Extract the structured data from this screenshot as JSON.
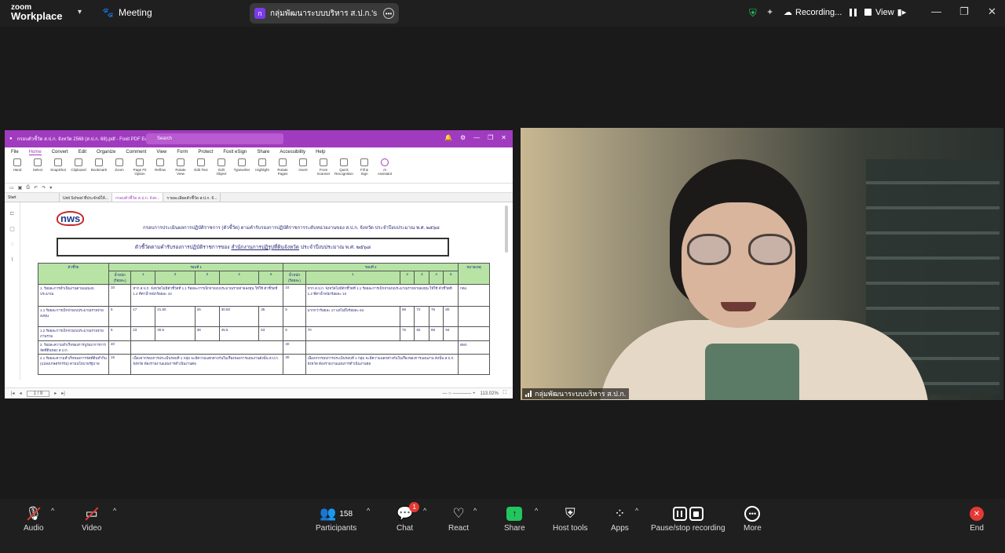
{
  "topbar": {
    "brand_top": "zoom",
    "brand_bottom": "Workplace",
    "meeting_label": "Meeting",
    "share_initial": "ก",
    "share_label": "กลุ่มพัฒนาระบบบริหาร ส.ป.ก.'s screen",
    "recording_label": "Recording...",
    "view_label": "View"
  },
  "pdf": {
    "title": "กรอบตัวชี้วัด ส.ป.ก. จังหวัด 2568 (ส.ป.ก. 68).pdf - Foxit PDF Editor",
    "search_placeholder": "Search",
    "menu": [
      "File",
      "Home",
      "Convert",
      "Edit",
      "Organize",
      "Comment",
      "View",
      "Form",
      "Protect",
      "Foxit eSign",
      "Share",
      "Accessibility",
      "Help"
    ],
    "ribbon": [
      "Hand",
      "Select",
      "SnapShot",
      "Clipboard",
      "Bookmark",
      "Zoom",
      "Page Fit Option",
      "Reflow",
      "Rotate View",
      "Edit Text",
      "Edit Object",
      "Typewriter",
      "Highlight",
      "Rotate Pages",
      "Insert",
      "From Scanner",
      "Quick Recognition",
      "Fill & Sign",
      "AI Assistant"
    ],
    "tabs": [
      "Start",
      "Unit School ที่ประจักษ์ให้...",
      "กรอบตัวชี้วัด ส.ป.ก. จังห...",
      "รายละเอียดตัวชี้วัด ส.ป.ก. จั..."
    ],
    "logo": "nws",
    "heading": "กรอบการประเมินผลการปฏิบัติราชการ (ตัวชี้วัด) ตามคำรับรองการปฏิบัติราชการระดับหน่วยงานของ ส.ป.ก. จังหวัด ประจำปีงบประมาณ พ.ศ. ๒๕๖๘",
    "box_text_a": "ตัวชี้วัดตามคำรับรองการปฏิบัติราชการของ",
    "box_text_u": "สำนักงานการปฏิรูปที่ดินจังหวัด",
    "box_text_b": "ประจำปีงบประมาณ พ.ศ. ๒๕๖๘",
    "table": {
      "h_indicator": "ตัวชี้วัด",
      "h_round1": "รอบที่ 1",
      "h_round2": "รอบที่ 2",
      "h_note": "หมายเหตุ",
      "h_weight": "น้ำหนัก (ร้อยละ)",
      "levels": [
        "1",
        "2",
        "3",
        "4",
        "5"
      ],
      "rows": [
        {
          "name": "1. ร้อยละการดำเนินงานตามแผนงบประมาณ",
          "w1": "10",
          "r1": "หาก ส.ป.ก. จังหวัดไม่มีตัวชี้วัดที่ 1.1 ร้อยละการเบิกจ่ายงบประมาณรายจ่ายลงทุน ให้ใช้ ตัวชี้วัดที่ 1.2 ที่ค่าน้ำหนักร้อยละ 10",
          "w2": "10",
          "r2": "หาก ส.ป.ก. จังหวัดไม่มีตัวชี้วัดที่ 1.1 ร้อยละการเบิกจ่ายงบประมาณรายจ่ายลงทุน ให้ใช้ ตัวชี้วัดที่ 1.2 ที่ค่าน้ำหนักร้อยละ 10",
          "note": "กคง."
        },
        {
          "name": "1.1 ร้อยละการเบิกจ่ายงบประมาณรายจ่ายลงทุน",
          "w1": "5",
          "c1": [
            "17",
            "21.50",
            "26",
            "30.50",
            "35"
          ],
          "w2": "5",
          "c2": [
            "มากกว่าร้อยละ 17 แต่ไม่ถึงร้อยละ 64",
            "68",
            "72",
            "76",
            "80"
          ],
          "note": ""
        },
        {
          "name": "1.2 ร้อยละการเบิกจ่ายงบประมาณรายจ่ายภาพรวม",
          "w1": "5",
          "c1": [
            "23",
            "30.5",
            "38",
            "45.5",
            "53"
          ],
          "w2": "5",
          "c2": [
            "70",
            "76",
            "82",
            "88",
            "94"
          ],
          "note": ""
        },
        {
          "name": "2. ร้อยละความสำเร็จของการบูรณาการการจัดที่ดินของ ส.ป.ก.",
          "w1": "40",
          "w2": "40",
          "note": "สพก."
        },
        {
          "name": "2.1 ร้อยละความสำเร็จของการจัดที่ดินทำกิน (แปลงเกษตรกรรม) ตามนโยบายรัฐบาล",
          "w1": "15",
          "r1": "เนื่องจากรอบการประเมินรอบที่ 1 กลุ่ม จะมีความแตกต่างกันในเรื่องของการแผนงานดังนั้น ส.ป.ก. จังหวัด ต้องรายงานแผนการดำเนินงานต่อ",
          "w2": "30",
          "r2": "เนื่องจากรอบการประเมินรอบที่ 1 กลุ่ม จะมีความแตกต่างกันในเรื่องของการแผนงาน ดังนั้น ส.ป.ก. จังหวัด ต้องรายงานแผนการดำเนินงานต่อ",
          "note": ""
        }
      ]
    },
    "page_indicator": "1 / 9",
    "zoom": "113.02%"
  },
  "video": {
    "name": "กลุ่มพัฒนาระบบบริหาร ส.ป.ก."
  },
  "toolbar": {
    "audio": "Audio",
    "video": "Video",
    "participants": "Participants",
    "participants_count": "158",
    "chat": "Chat",
    "chat_badge": "1",
    "react": "React",
    "share": "Share",
    "host_tools": "Host tools",
    "apps": "Apps",
    "recording": "Pause/stop recording",
    "more": "More",
    "end": "End"
  },
  "colors": {
    "foxit_purple": "#a03bbf",
    "share_green": "#22c55e",
    "alert_red": "#e53935",
    "table_header_green": "#b7e4a5"
  }
}
